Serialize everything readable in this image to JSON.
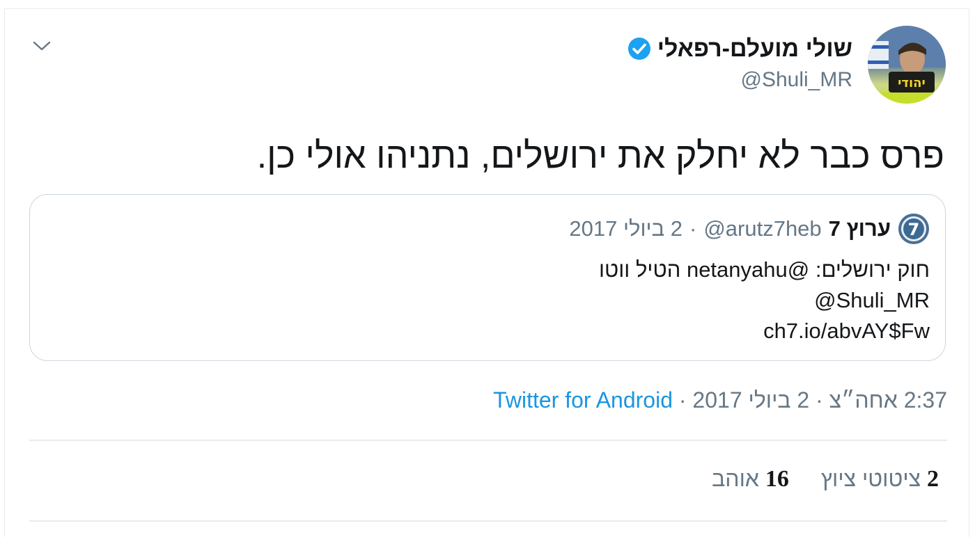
{
  "author": {
    "name": "שולי מועלם-רפאלי",
    "handle": "@Shuli_MR",
    "avatar_badge_text": "יהודי"
  },
  "tweet": {
    "text": "פרס כבר לא יחלק את ירושלים, נתניהו אולי כן."
  },
  "quoted_tweet": {
    "name": "ערוץ 7",
    "handle": "@arutz7heb",
    "separator": "·",
    "date": "2 ביולי 2017",
    "lines": [
      "חוק ירושלים: @netanyahu הטיל ווטו",
      "@Shuli_MR",
      "ch7.io/abvAY$Fw"
    ],
    "logo_digit": "7"
  },
  "meta": {
    "time": "2:37 אחה״צ",
    "separator": "·",
    "date": "2 ביולי 2017",
    "source": "Twitter for Android"
  },
  "stats": {
    "retweets_count": "2",
    "retweets_label": "ציטוטי ציוץ",
    "likes_count": "16",
    "likes_label": "אוהב"
  },
  "colors": {
    "verified": "#1da1f2",
    "link": "#1b95e0",
    "secondary_text": "#657786",
    "border": "#e6ecf0"
  },
  "icons": [
    "chevron-down-icon",
    "verified-badge-icon",
    "arutz7-logo-icon"
  ]
}
